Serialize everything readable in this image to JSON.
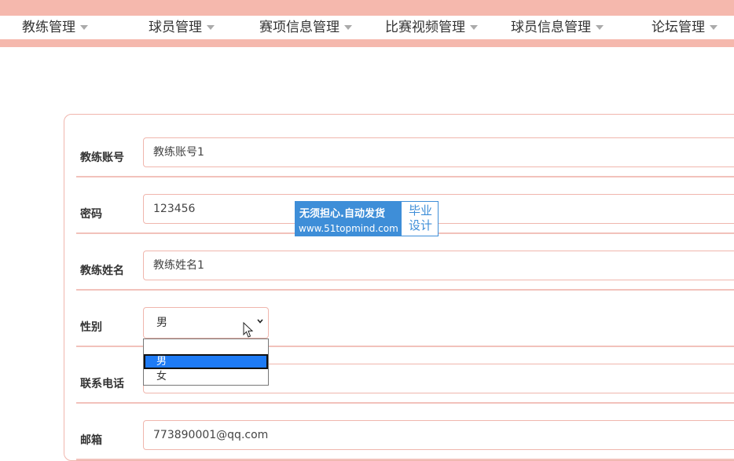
{
  "nav": {
    "items": [
      {
        "label": "教练管理"
      },
      {
        "label": "球员管理"
      },
      {
        "label": "赛项信息管理"
      },
      {
        "label": "比赛视频管理"
      },
      {
        "label": "球员信息管理"
      },
      {
        "label": "论坛管理"
      }
    ]
  },
  "form": {
    "account": {
      "label": "教练账号",
      "value": "教练账号1"
    },
    "password": {
      "label": "密码",
      "value": "123456"
    },
    "name": {
      "label": "教练姓名",
      "value": "教练姓名1"
    },
    "gender": {
      "label": "性别",
      "value": "男",
      "options": [
        "",
        "男",
        "女"
      ]
    },
    "phone": {
      "label": "联系电话",
      "value": ""
    },
    "email": {
      "label": "邮箱",
      "value": "773890001@qq.com"
    }
  },
  "watermark": {
    "line1": "无须担心.自动发货",
    "line2": "www.51topmind.com",
    "badge_line1": "毕业",
    "badge_line2": "设计"
  },
  "colors": {
    "accent": "#f5b8ad",
    "highlight": "#1e7bf5",
    "watermark": "#3e8ed8"
  }
}
